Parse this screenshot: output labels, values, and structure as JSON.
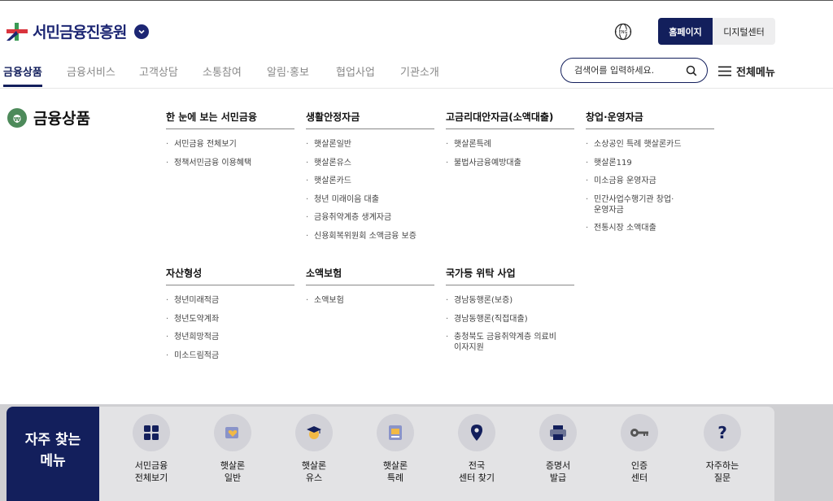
{
  "header": {
    "logo_text": "서민금융진흥원",
    "home_button": "홈페이지",
    "digital_button": "디지털센터",
    "globe_label": "ENG"
  },
  "nav": {
    "items": [
      "금융상품",
      "금융서비스",
      "고객상담",
      "소통참여",
      "알림·홍보",
      "협업사업",
      "기관소개"
    ],
    "search_placeholder": "검색어를 입력하세요.",
    "all_menu": "전체메뉴"
  },
  "section": {
    "title": "금융상품"
  },
  "columns": [
    {
      "title": "한 눈에 보는 서민금융",
      "items": [
        "서민금융 전체보기",
        "정책서민금융 이용혜택"
      ]
    },
    {
      "title": "생활안정자금",
      "items": [
        "햇살론일반",
        "햇살론유스",
        "햇살론카드",
        "청년 미래이음 대출",
        "금융취약계층 생계자금",
        "신용회복위원회 소액금융 보증"
      ]
    },
    {
      "title": "고금리대안자금(소액대출)",
      "items": [
        "햇살론특례",
        "불법사금융예방대출"
      ]
    },
    {
      "title": "창업·운영자금",
      "items": [
        "소상공인 특례 햇살론카드",
        "햇살론119",
        "미소금융 운영자금",
        "민간사업수행기관 창업·\n운영자금",
        "전통시장 소액대출"
      ]
    },
    {
      "title": "자산형성",
      "items": [
        "청년미래적금",
        "청년도약계좌",
        "청년희망적금",
        "미소드림적금"
      ]
    },
    {
      "title": "소액보험",
      "items": [
        "소액보험"
      ]
    },
    {
      "title": "국가등 위탁 사업",
      "items": [
        "경남동행론(보증)",
        "경남동행론(직접대출)",
        "충청북도 금융취약계층 의료비\n이자지원"
      ]
    }
  ],
  "quick": {
    "label_line1": "자주 찾는",
    "label_line2": "메뉴",
    "items": [
      {
        "line1": "서민금융",
        "line2": "전체보기",
        "icon": "grid-icon"
      },
      {
        "line1": "햇살론",
        "line2": "일반",
        "icon": "heart-card-icon"
      },
      {
        "line1": "햇살론",
        "line2": "유스",
        "icon": "graduate-icon"
      },
      {
        "line1": "햇살론",
        "line2": "특례",
        "icon": "document-icon"
      },
      {
        "line1": "전국",
        "line2": "센터 찾기",
        "icon": "location-pin-icon"
      },
      {
        "line1": "증명서",
        "line2": "발급",
        "icon": "printer-icon"
      },
      {
        "line1": "인증",
        "line2": "센터",
        "icon": "key-icon"
      },
      {
        "line1": "자주하는",
        "line2": "질문",
        "icon": "question-icon"
      }
    ]
  },
  "colors": {
    "navy": "#131f5c",
    "accent_red": "#d9343d",
    "accent_green": "#3a9a54"
  }
}
